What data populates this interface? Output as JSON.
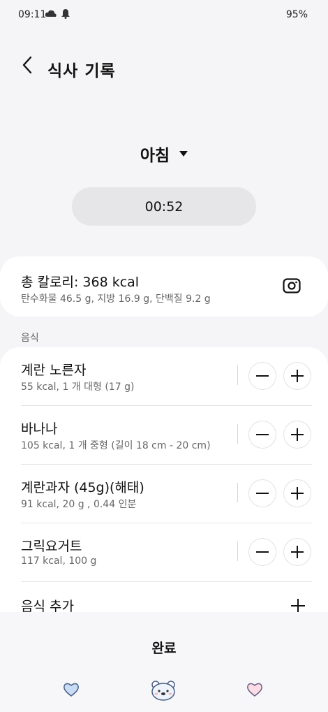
{
  "status_bar": {
    "time": "09:11",
    "battery": "95%",
    "icons": [
      "cloud-icon",
      "bell-icon"
    ]
  },
  "header": {
    "title": "식사 기록",
    "back_icon": "chevron-left-icon"
  },
  "meal": {
    "label": "아침",
    "dropdown_icon": "caret-down-icon"
  },
  "timer": "00:52",
  "calories": {
    "total": "총 칼로리: 368 kcal",
    "macros": "탄수화물 46.5 g, 지방 16.9 g, 단백질 9.2 g",
    "camera_icon": "camera-icon"
  },
  "food_section_label": "음식",
  "foods": [
    {
      "name": "계란 노른자",
      "detail": "55 kcal, 1 개 대형 (17 g)"
    },
    {
      "name": "바나나",
      "detail": "105 kcal, 1 개 중형 (길이 18 cm - 20 cm)"
    },
    {
      "name": "계란과자 (45g)(해태)",
      "detail": "91 kcal, 20 g , 0.44 인분"
    },
    {
      "name": "그릭요거트",
      "detail": "117 kcal, 100 g"
    }
  ],
  "add_food_label": "음식 추가",
  "done_label": "완료",
  "bottom_nav": {
    "icons": [
      "heart-blue-icon",
      "bear-face-icon",
      "heart-pink-icon"
    ]
  },
  "colors": {
    "background": "#f5f5f7",
    "card": "#ffffff",
    "pill": "#e6e6e8",
    "secondary_text": "#666666"
  }
}
